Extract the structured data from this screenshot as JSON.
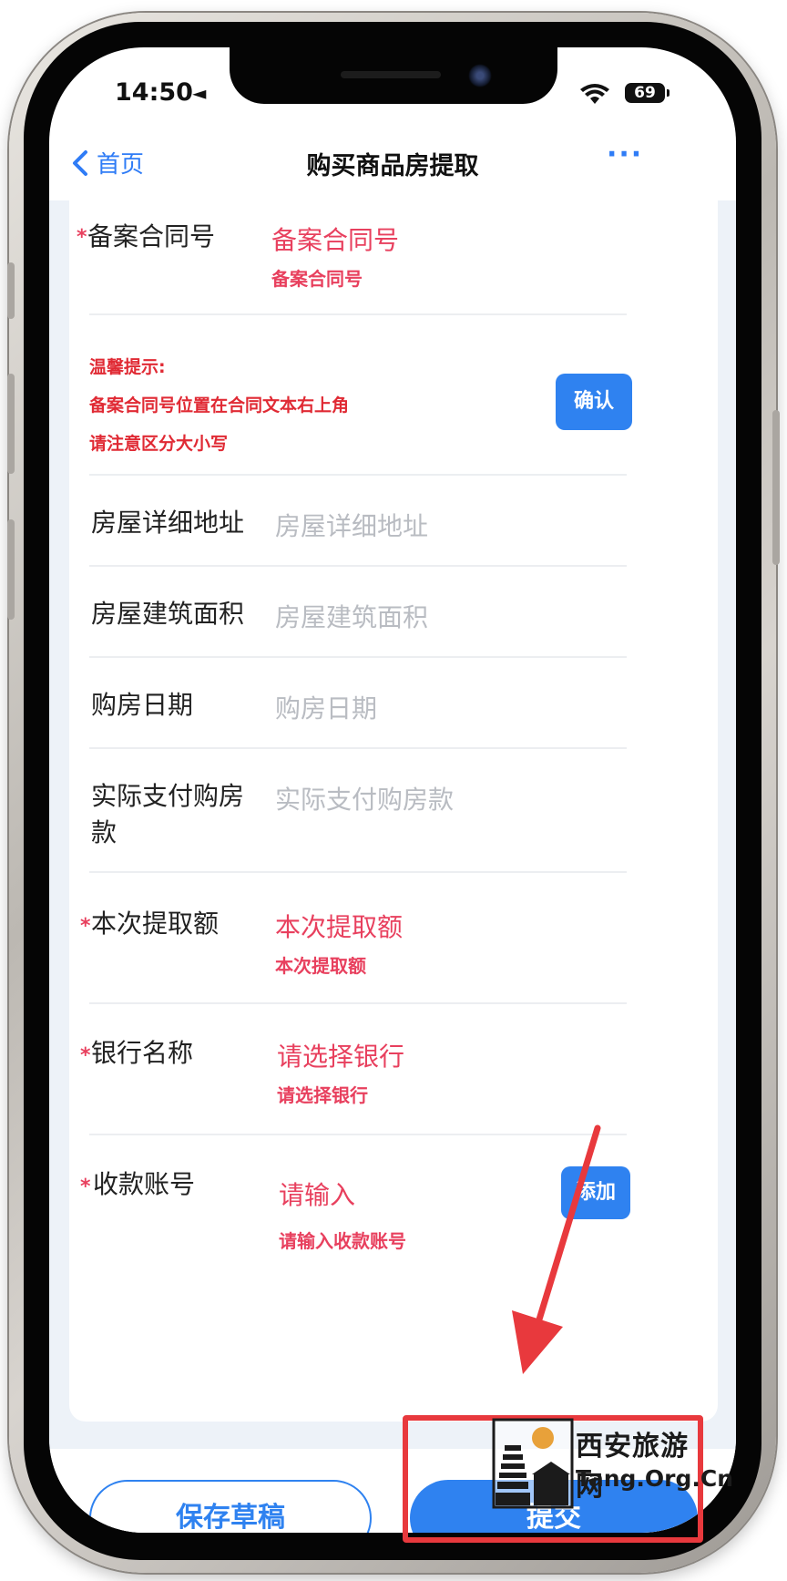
{
  "status_bar": {
    "time": "14:50",
    "extra": "◄",
    "battery": "69"
  },
  "nav": {
    "back_label": "首页",
    "title": "购买商品房提取",
    "more": "···"
  },
  "form": {
    "contract_no": {
      "label": "备案合同号",
      "value": "备案合同号",
      "hint": "备案合同号"
    },
    "tip": {
      "title": "温馨提示:",
      "line1": "备案合同号位置在合同文本右上角",
      "line2": "请注意区分大小写",
      "confirm_label": "确认"
    },
    "address": {
      "label": "房屋详细地址",
      "placeholder": "房屋详细地址"
    },
    "area": {
      "label": "房屋建筑面积",
      "placeholder": "房屋建筑面积"
    },
    "purchase_date": {
      "label": "购房日期",
      "placeholder": "购房日期"
    },
    "payment": {
      "label_line1": "实际支付购房",
      "label_line2": "款",
      "placeholder": "实际支付购房款"
    },
    "withdraw_amount": {
      "label": "本次提取额",
      "value": "本次提取额",
      "hint": "本次提取额"
    },
    "bank": {
      "label": "银行名称",
      "value": "请选择银行",
      "hint": "请选择银行"
    },
    "account": {
      "label": "收款账号",
      "value": "请输入",
      "hint": "请输入收款账号",
      "add_label": "添加"
    }
  },
  "footer": {
    "save_label": "保存草稿",
    "submit_label": "提交"
  },
  "watermark": {
    "cn": "西安旅游网",
    "en": "Tang.Org.Cn"
  },
  "colors": {
    "accent": "#2f82f0",
    "required": "#e8405e",
    "annotation": "#e8393d"
  }
}
